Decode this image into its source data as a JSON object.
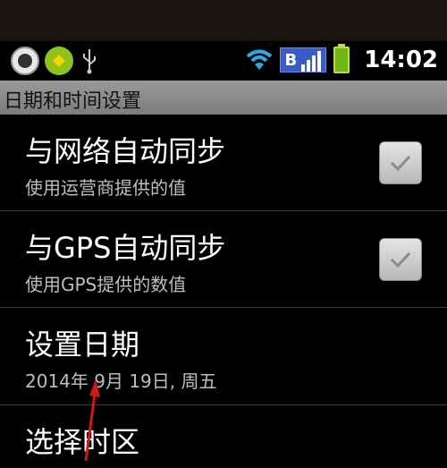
{
  "status_bar": {
    "time": "14:02",
    "network_letter": "B",
    "icons": [
      "notification-round-icon",
      "notification-green-icon",
      "usb-icon",
      "wifi-icon",
      "signal-icon",
      "battery-icon"
    ]
  },
  "screen": {
    "title": "日期和时间设置"
  },
  "settings": [
    {
      "title": "与网络自动同步",
      "summary": "使用运营商提供的值",
      "checked": true
    },
    {
      "title": "与GPS自动同步",
      "summary": "使用GPS提供的数值",
      "checked": true
    },
    {
      "title": "设置日期",
      "summary": "2014年 9月 19日, 周五"
    },
    {
      "title": "选择时区"
    }
  ],
  "colors": {
    "title_bar": "#8a8a8a",
    "annotation_arrow": "#d01818",
    "wifi": "#2fa8e0",
    "signal_badge": "#3a5cc8",
    "battery": "#6fb817"
  }
}
